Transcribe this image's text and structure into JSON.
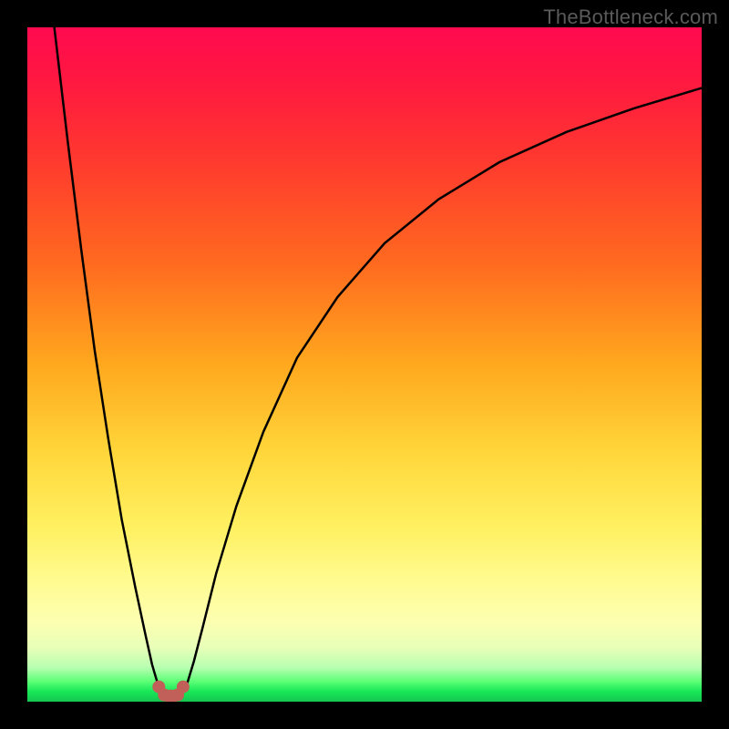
{
  "watermark": "TheBottleneck.com",
  "colors": {
    "page_bg": "#000000",
    "curve_stroke": "#000000",
    "marker_fill": "#c06058",
    "gradient_top": "#ff0a4f",
    "gradient_mid": "#ffd63a",
    "gradient_bottom": "#16c552"
  },
  "chart_data": {
    "type": "line",
    "title": "",
    "xlabel": "",
    "ylabel": "",
    "xlim": [
      0,
      100
    ],
    "ylim": [
      0,
      100
    ],
    "grid": false,
    "legend": false,
    "series": [
      {
        "name": "Bottleneck curve (left branch)",
        "x": [
          4,
          6,
          8,
          10,
          12,
          14,
          16,
          17.5,
          18.5,
          19.3,
          20.0
        ],
        "values": [
          100,
          83,
          67,
          52,
          39,
          27,
          17,
          10,
          5.5,
          2.8,
          1.2
        ]
      },
      {
        "name": "Bottleneck curve (right branch)",
        "x": [
          23.0,
          23.8,
          24.7,
          26,
          28,
          31,
          35,
          40,
          46,
          53,
          61,
          70,
          80,
          90,
          100
        ],
        "values": [
          1.2,
          3.0,
          6.0,
          11,
          19,
          29,
          40,
          51,
          60,
          68,
          74.5,
          80,
          84.5,
          88,
          91
        ]
      }
    ],
    "markers": {
      "name": "Sweet-spot markers",
      "x": [
        19.5,
        20.3,
        21.3,
        22.3,
        23.1
      ],
      "values": [
        2.2,
        1.0,
        0.7,
        1.0,
        2.2
      ]
    },
    "background_gradient": {
      "axis": "y",
      "stops": [
        {
          "pos": 0,
          "color": "#16c552"
        },
        {
          "pos": 3,
          "color": "#5cff76"
        },
        {
          "pos": 8,
          "color": "#e8ffb8"
        },
        {
          "pos": 18,
          "color": "#fffb90"
        },
        {
          "pos": 37,
          "color": "#ffd63a"
        },
        {
          "pos": 60,
          "color": "#ff6a1f"
        },
        {
          "pos": 100,
          "color": "#ff0a4f"
        }
      ]
    }
  }
}
